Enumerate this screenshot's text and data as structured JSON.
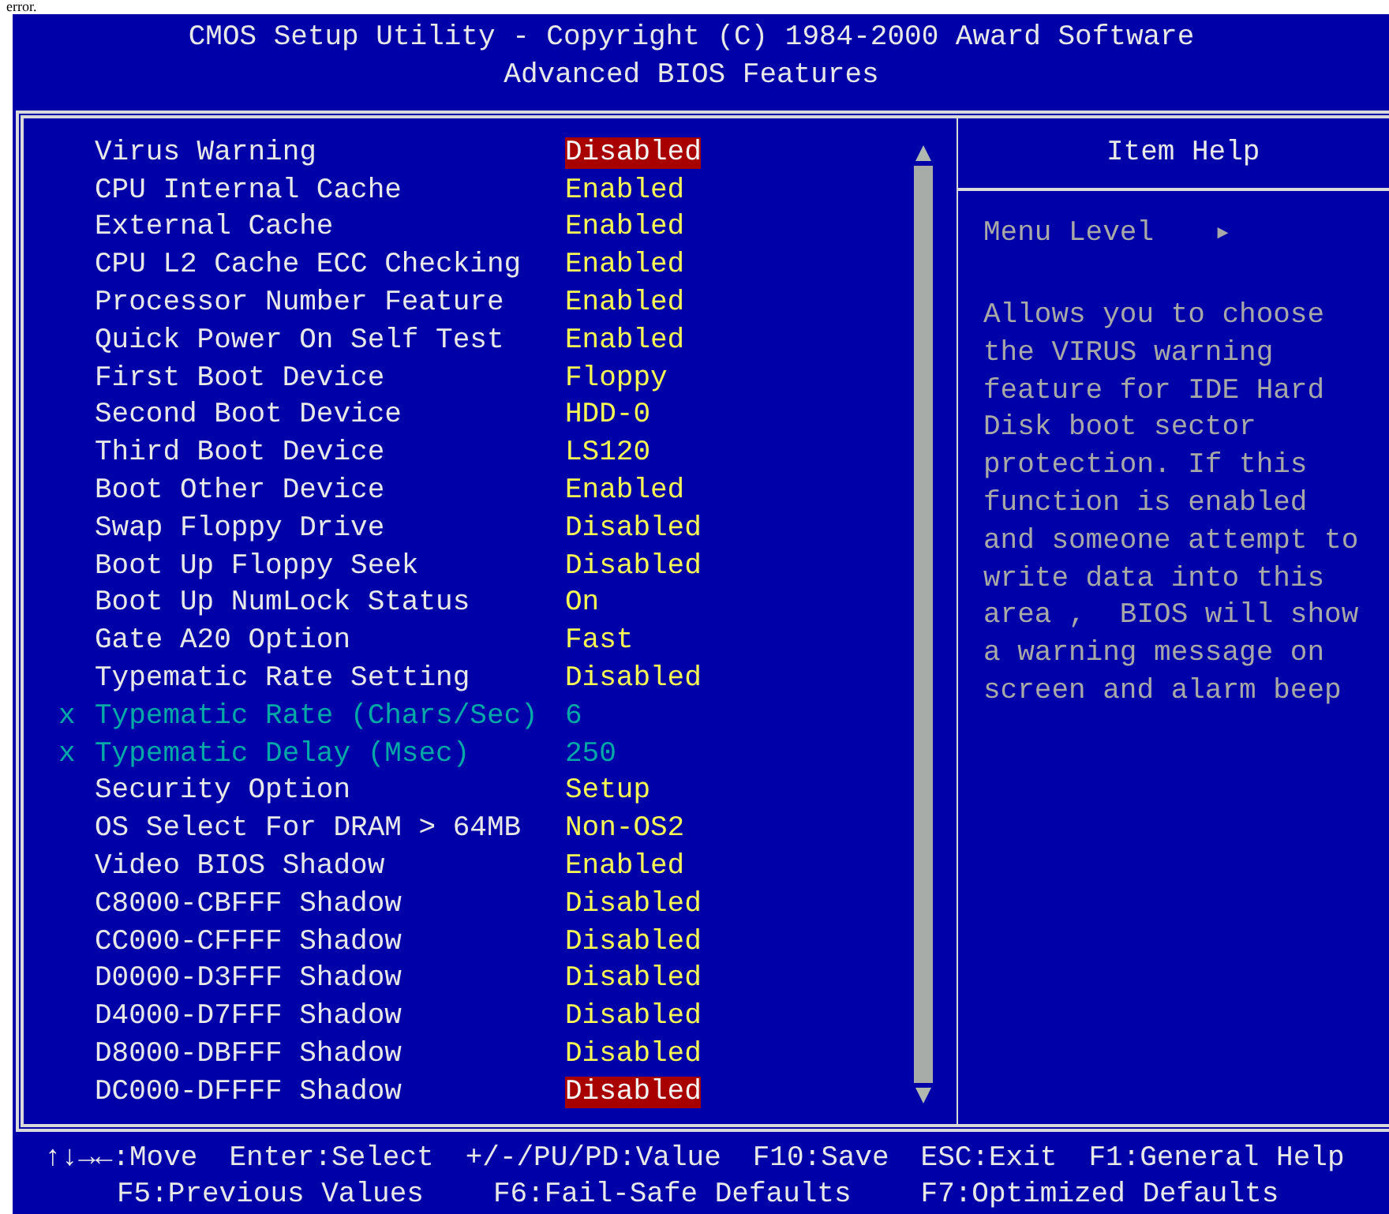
{
  "page_note": "error.",
  "header": {
    "title": "CMOS Setup Utility - Copyright (C) 1984-2000 Award Software",
    "subtitle": "Advanced BIOS Features"
  },
  "settings": [
    {
      "label": "Virus Warning",
      "value": "Disabled",
      "highlighted": true,
      "disabled": false
    },
    {
      "label": "CPU Internal Cache",
      "value": "Enabled",
      "highlighted": false,
      "disabled": false
    },
    {
      "label": "External Cache",
      "value": "Enabled",
      "highlighted": false,
      "disabled": false
    },
    {
      "label": "CPU L2 Cache ECC Checking",
      "value": "Enabled",
      "highlighted": false,
      "disabled": false
    },
    {
      "label": "Processor Number Feature",
      "value": "Enabled",
      "highlighted": false,
      "disabled": false
    },
    {
      "label": "Quick Power On Self Test",
      "value": "Enabled",
      "highlighted": false,
      "disabled": false
    },
    {
      "label": "First Boot Device",
      "value": "Floppy",
      "highlighted": false,
      "disabled": false
    },
    {
      "label": "Second Boot Device",
      "value": "HDD-0",
      "highlighted": false,
      "disabled": false
    },
    {
      "label": "Third Boot Device",
      "value": "LS120",
      "highlighted": false,
      "disabled": false
    },
    {
      "label": "Boot Other Device",
      "value": "Enabled",
      "highlighted": false,
      "disabled": false
    },
    {
      "label": "Swap Floppy Drive",
      "value": "Disabled",
      "highlighted": false,
      "disabled": false
    },
    {
      "label": "Boot Up Floppy Seek",
      "value": "Disabled",
      "highlighted": false,
      "disabled": false
    },
    {
      "label": "Boot Up NumLock Status",
      "value": "On",
      "highlighted": false,
      "disabled": false
    },
    {
      "label": "Gate A20 Option",
      "value": "Fast",
      "highlighted": false,
      "disabled": false
    },
    {
      "label": "Typematic Rate Setting",
      "value": "Disabled",
      "highlighted": false,
      "disabled": false
    },
    {
      "prefix": "x",
      "label": "Typematic Rate (Chars/Sec)",
      "value": "6",
      "highlighted": false,
      "disabled": true
    },
    {
      "prefix": "x",
      "label": "Typematic Delay (Msec)",
      "value": "250",
      "highlighted": false,
      "disabled": true
    },
    {
      "label": "Security Option",
      "value": "Setup",
      "highlighted": false,
      "disabled": false
    },
    {
      "label": "OS Select For DRAM > 64MB",
      "value": "Non-OS2",
      "highlighted": false,
      "disabled": false
    },
    {
      "label": "Video BIOS Shadow",
      "value": "Enabled",
      "highlighted": false,
      "disabled": false
    },
    {
      "label": "C8000-CBFFF Shadow",
      "value": "Disabled",
      "highlighted": false,
      "disabled": false
    },
    {
      "label": "CC000-CFFFF Shadow",
      "value": "Disabled",
      "highlighted": false,
      "disabled": false
    },
    {
      "label": "D0000-D3FFF Shadow",
      "value": "Disabled",
      "highlighted": false,
      "disabled": false
    },
    {
      "label": "D4000-D7FFF Shadow",
      "value": "Disabled",
      "highlighted": false,
      "disabled": false
    },
    {
      "label": "D8000-DBFFF Shadow",
      "value": "Disabled",
      "highlighted": false,
      "disabled": false
    },
    {
      "label": "DC000-DFFFF Shadow",
      "value": "Disabled",
      "highlighted": true,
      "disabled": false
    }
  ],
  "item_help": {
    "title": "Item Help",
    "menu_level": {
      "label": "Menu Level",
      "arrow": "►"
    },
    "text_lines": [
      "Allows you to choose",
      "the VIRUS warning",
      "feature for IDE Hard",
      "Disk boot sector",
      "protection. If this",
      "function is enabled",
      "and someone attempt to",
      "write data into this",
      "area ,  BIOS will show",
      "a warning message on",
      "screen and alarm beep"
    ]
  },
  "footer": [
    [
      "↑↓→←:Move",
      "Enter:Select",
      "+/-/PU/PD:Value",
      "F10:Save",
      "ESC:Exit",
      "F1:General Help"
    ],
    [
      "F5:Previous Values",
      "F6:Fail-Safe Defaults",
      "F7:Optimized Defaults"
    ]
  ]
}
